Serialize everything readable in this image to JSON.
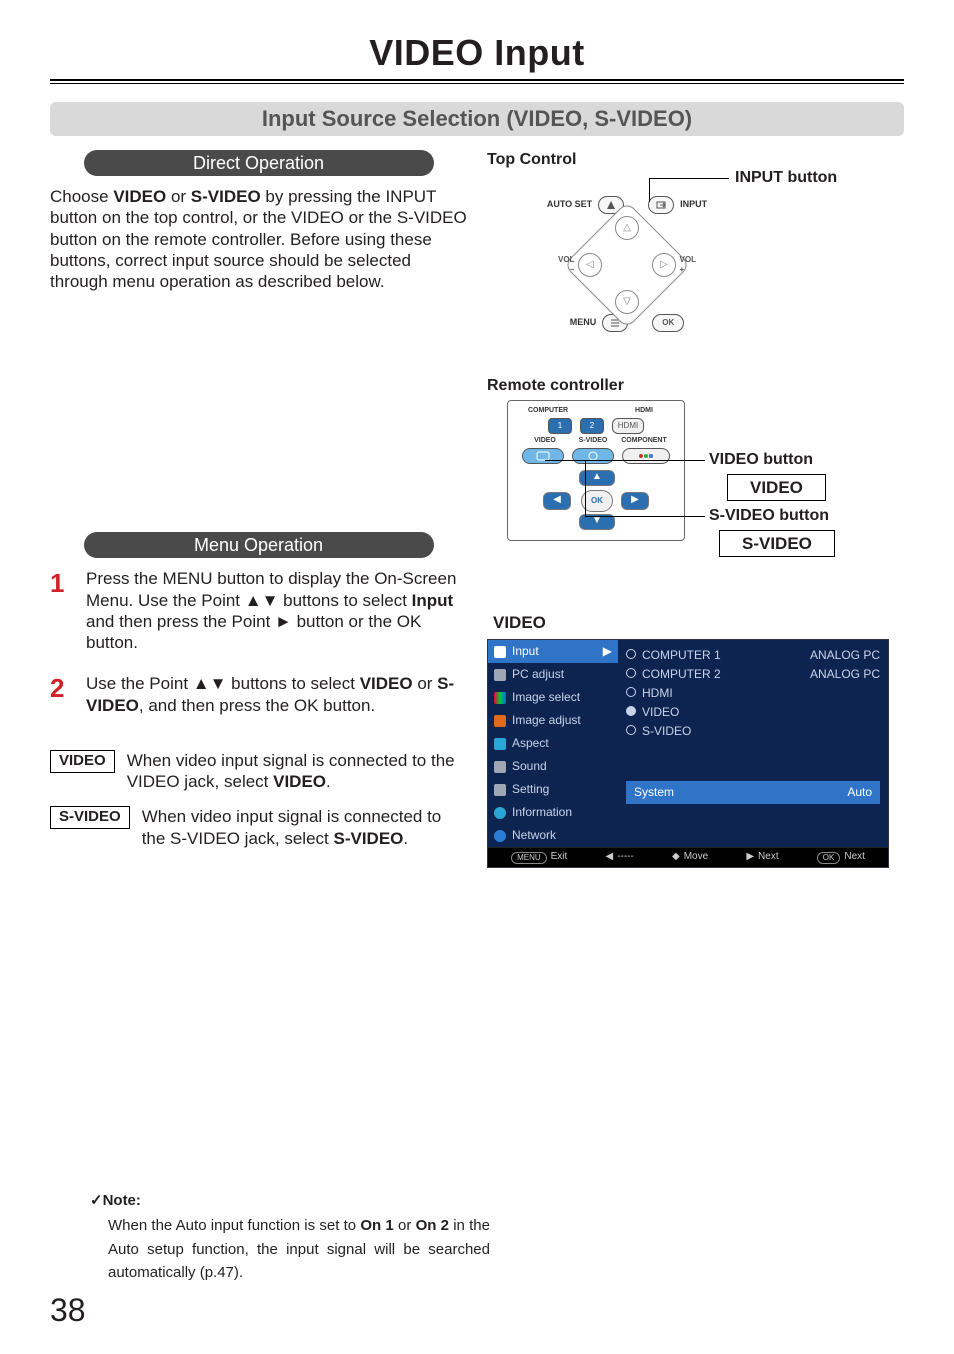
{
  "chapter_title": "VIDEO Input",
  "section_title": "Input Source Selection (VIDEO, S-VIDEO)",
  "direct_operation": {
    "header": "Direct Operation",
    "body_parts": [
      "Choose ",
      "VIDEO",
      " or ",
      "S-VIDEO",
      " by pressing the INPUT button on the top control, or the VIDEO or the S-VIDEO button on the remote controller. Before using these buttons, correct input source should be selected through menu operation as described below."
    ]
  },
  "menu_operation": {
    "header": "Menu Operation",
    "steps": [
      {
        "num": "1",
        "parts": [
          "Press the MENU button to display the On-Screen Menu. Use the Point ▲▼ buttons to select ",
          "Input",
          " and then press the Point ► button or the OK button."
        ]
      },
      {
        "num": "2",
        "parts": [
          "Use the Point ▲▼ buttons to select ",
          "VIDEO",
          " or ",
          "S-VIDEO",
          ", and then press the OK button."
        ]
      }
    ],
    "options": [
      {
        "label": "VIDEO",
        "parts": [
          "When video input signal is connected to the VIDEO jack, select ",
          "VIDEO",
          "."
        ]
      },
      {
        "label": "S-VIDEO",
        "parts": [
          "When video input signal is connected to the S-VIDEO jack, select ",
          "S-VIDEO",
          "."
        ]
      }
    ]
  },
  "right": {
    "top_control": {
      "title": "Top Control",
      "auto_set": "AUTO SET",
      "input": "INPUT",
      "menu": "MENU",
      "ok": "OK",
      "vol": "VOL",
      "callout": "INPUT button"
    },
    "remote": {
      "title": "Remote controller",
      "labels_top": [
        "COMPUTER",
        "HDMI"
      ],
      "labels_row2": [
        "VIDEO",
        "S-VIDEO",
        "COMPONENT"
      ],
      "ok": "OK",
      "callout_video": "VIDEO button",
      "box_video": "VIDEO",
      "callout_svideo": "S-VIDEO button",
      "box_svideo": "S-VIDEO"
    },
    "osd": {
      "title": "VIDEO",
      "left_items": [
        "Input",
        "PC adjust",
        "Image select",
        "Image adjust",
        "Aspect",
        "Sound",
        "Setting",
        "Information",
        "Network"
      ],
      "right_items": [
        {
          "label": "COMPUTER 1",
          "right": "ANALOG PC",
          "selected": false
        },
        {
          "label": "COMPUTER 2",
          "right": "ANALOG PC",
          "selected": false
        },
        {
          "label": "HDMI",
          "right": "",
          "selected": false
        },
        {
          "label": "VIDEO",
          "right": "",
          "selected": true
        },
        {
          "label": "S-VIDEO",
          "right": "",
          "selected": false
        }
      ],
      "system_label": "System",
      "system_value": "Auto",
      "bar": {
        "exit": "Exit",
        "back": "-----",
        "move": "Move",
        "next": "Next",
        "ok_next": "Next"
      }
    }
  },
  "note": {
    "title": "✓Note:",
    "body_parts": [
      "When the Auto input function is set to ",
      "On 1",
      " or ",
      "On 2",
      " in the Auto setup function, the input signal will be searched automatically (p.47)."
    ]
  },
  "page_number": "38"
}
